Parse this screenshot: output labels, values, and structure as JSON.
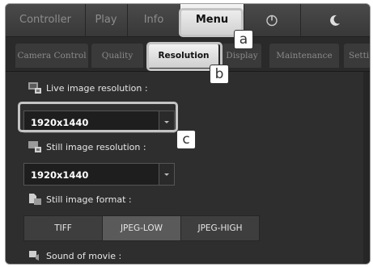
{
  "top_tabs": [
    {
      "label": "Controller"
    },
    {
      "label": "Play"
    },
    {
      "label": "Info"
    },
    {
      "label": "Menu"
    },
    {
      "icon": "power-icon"
    },
    {
      "icon": "moon-icon"
    }
  ],
  "sub_tabs": [
    {
      "label": "Camera Control"
    },
    {
      "label": "Quality"
    },
    {
      "label": "Resolution"
    },
    {
      "label": "Display"
    },
    {
      "label": "Maintenance"
    },
    {
      "label": "Setti"
    }
  ],
  "settings": {
    "live_label": "Live image resolution :",
    "live_value": "1920x1440",
    "still_label": "Still image resolution :",
    "still_value": "1920x1440",
    "format_label": "Still image format :",
    "format_options": [
      "TIFF",
      "JPEG-LOW",
      "JPEG-HIGH"
    ],
    "format_selected": "JPEG-LOW",
    "sound_label": "Sound of movie :"
  },
  "callouts": {
    "a": "a",
    "b": "b",
    "c": "c"
  },
  "colors": {
    "active_tab": "#e8e8e8",
    "panel": "#2e2e2e",
    "callout_border": "#c4c4c4"
  }
}
